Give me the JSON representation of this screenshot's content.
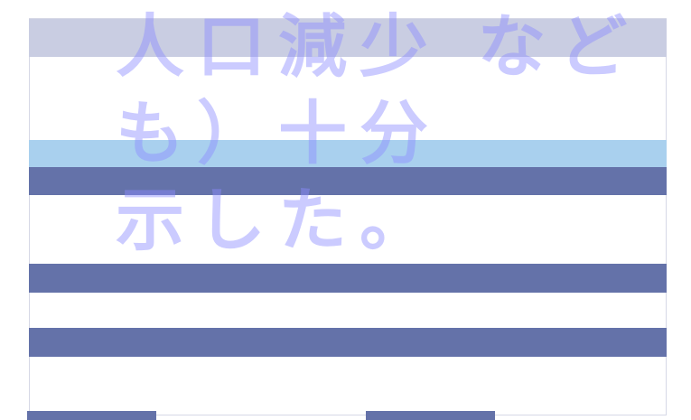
{
  "watermark": {
    "line1": "人口減少 など",
    "line2": "も）十分",
    "line3": "示した。"
  },
  "colors": {
    "band_top": "#c9cde2",
    "band_light": "#a9d0ee",
    "band_dark": "#6472a9",
    "watermark": "#8c8cff"
  }
}
